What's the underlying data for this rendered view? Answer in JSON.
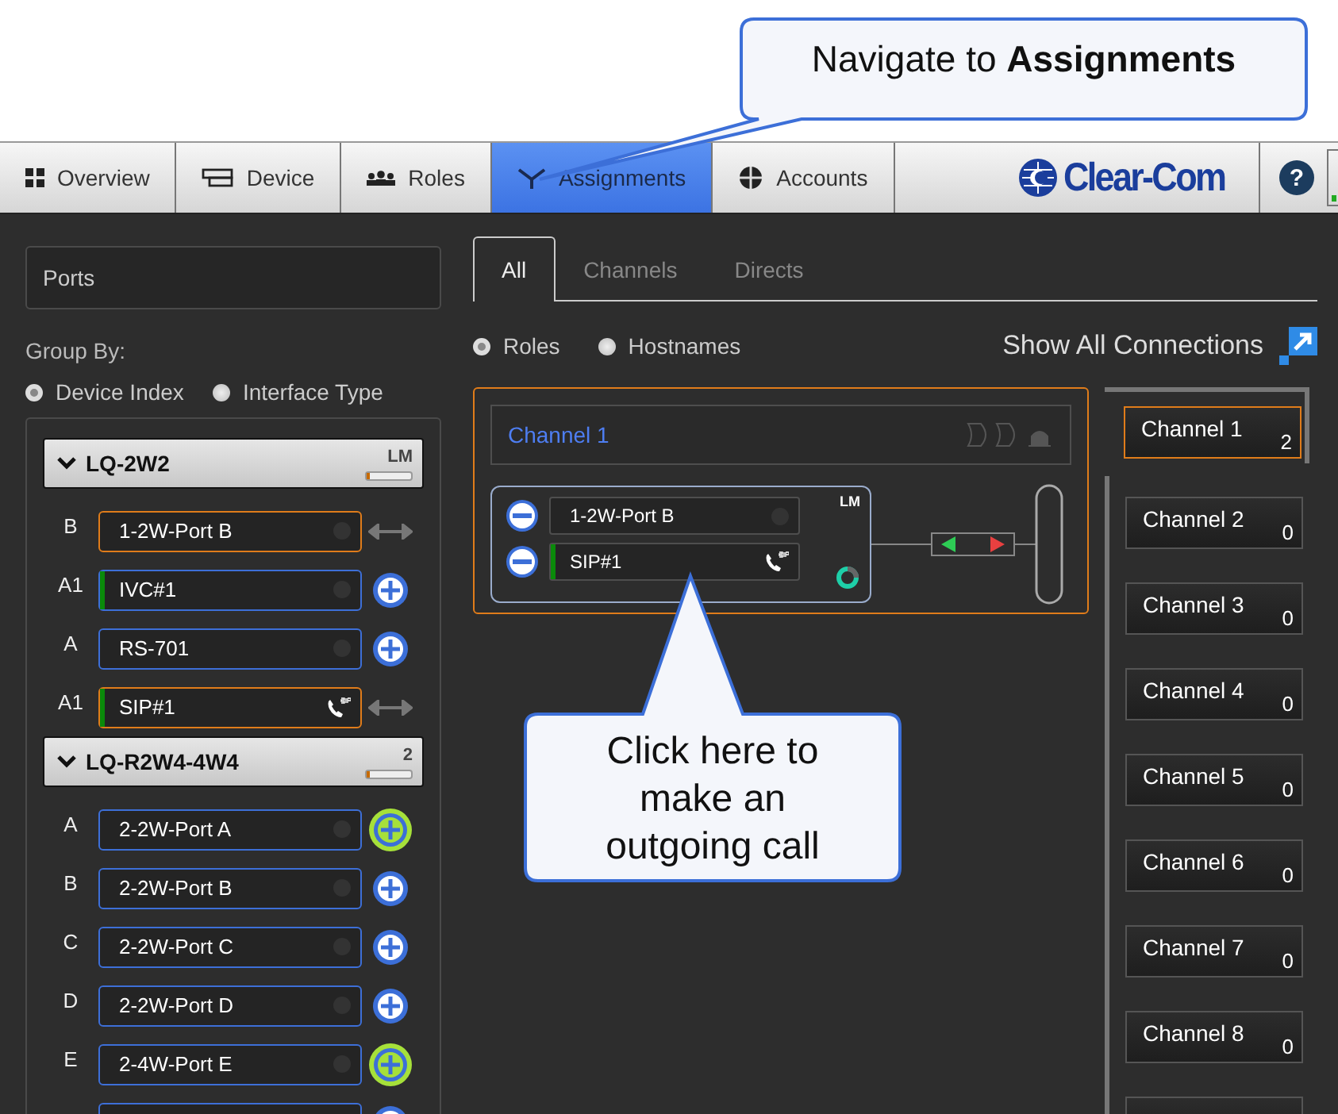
{
  "callouts": [
    {
      "text": "Navigate to **Assignments**"
    },
    {
      "text": "Click here to make an outgoing call"
    }
  ],
  "nav_tabs": [
    {
      "label": "Overview",
      "selected": false
    },
    {
      "label": "Device",
      "selected": false
    },
    {
      "label": "Roles",
      "selected": false
    },
    {
      "label": "Assignments",
      "selected": true
    },
    {
      "label": "Accounts",
      "selected": false
    }
  ],
  "brand": {
    "logo": "Clear-Com",
    "help": "?"
  },
  "search": {
    "placeholder": "Ports"
  },
  "group_by": {
    "label": "Group By:",
    "options": [
      {
        "label": "Device Index",
        "selected": true
      },
      {
        "label": "Interface Type",
        "selected": false
      }
    ]
  },
  "devices": [
    {
      "name": "LQ-2W2",
      "badge": "LM",
      "level": 0.08,
      "ports": [
        {
          "index": "B",
          "name": "1-2W-Port B",
          "assigned": true,
          "live": false,
          "sip": false,
          "kind": "linked"
        },
        {
          "index": "A1",
          "name": "IVC#1",
          "assigned": false,
          "live": true,
          "sip": false,
          "kind": "add",
          "highlighted": false
        },
        {
          "index": "A",
          "name": "RS-701",
          "assigned": false,
          "live": false,
          "sip": false,
          "kind": "add",
          "highlighted": false
        },
        {
          "index": "A1",
          "name": "SIP#1",
          "assigned": true,
          "live": true,
          "sip": true,
          "kind": "linked"
        }
      ]
    },
    {
      "name": "LQ-R2W4-4W4",
      "badge": "2",
      "level": 0.08,
      "ports": [
        {
          "index": "A",
          "name": "2-2W-Port A",
          "assigned": false,
          "live": false,
          "sip": false,
          "kind": "add",
          "highlighted": true
        },
        {
          "index": "B",
          "name": "2-2W-Port B",
          "assigned": false,
          "live": false,
          "sip": false,
          "kind": "add",
          "highlighted": false
        },
        {
          "index": "C",
          "name": "2-2W-Port C",
          "assigned": false,
          "live": false,
          "sip": false,
          "kind": "add",
          "highlighted": false
        },
        {
          "index": "D",
          "name": "2-2W-Port D",
          "assigned": false,
          "live": false,
          "sip": false,
          "kind": "add",
          "highlighted": false
        },
        {
          "index": "E",
          "name": "2-4W-Port E",
          "assigned": false,
          "live": false,
          "sip": false,
          "kind": "add",
          "highlighted": true
        }
      ]
    }
  ],
  "view_tabs": [
    {
      "label": "All",
      "selected": true
    },
    {
      "label": "Channels",
      "selected": false
    },
    {
      "label": "Directs",
      "selected": false
    }
  ],
  "display_by": [
    {
      "label": "Roles",
      "selected": true
    },
    {
      "label": "Hostnames",
      "selected": false
    }
  ],
  "show_all_connections": "Show All Connections",
  "channel_card": {
    "title": "Channel 1",
    "badge": "LM",
    "members": [
      {
        "name": "1-2W-Port B",
        "live": false,
        "sip": false
      },
      {
        "name": "SIP#1",
        "live": true,
        "sip": true
      }
    ]
  },
  "channels": [
    {
      "name": "Channel 1",
      "count": "2",
      "selected": true
    },
    {
      "name": "Channel 2",
      "count": "0",
      "selected": false
    },
    {
      "name": "Channel 3",
      "count": "0",
      "selected": false
    },
    {
      "name": "Channel 4",
      "count": "0",
      "selected": false
    },
    {
      "name": "Channel 5",
      "count": "0",
      "selected": false
    },
    {
      "name": "Channel 6",
      "count": "0",
      "selected": false
    },
    {
      "name": "Channel 7",
      "count": "0",
      "selected": false
    },
    {
      "name": "Channel 8",
      "count": "0",
      "selected": false
    }
  ]
}
